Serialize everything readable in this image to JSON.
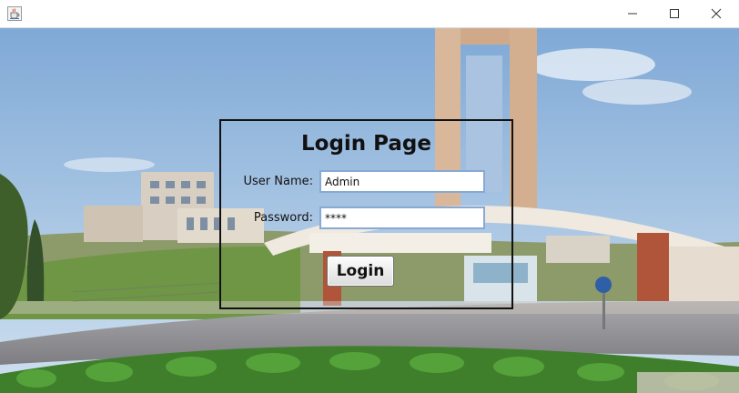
{
  "window": {
    "app_icon": "java-cup-icon",
    "controls": {
      "minimize_icon": "minimize-icon",
      "maximize_icon": "maximize-icon",
      "close_icon": "close-icon"
    }
  },
  "background": {
    "description_icon": "campus-photo"
  },
  "login": {
    "title": "Login Page",
    "username_label": "User Name:",
    "username_value": "Admin",
    "password_label": "Password:",
    "password_value": "****",
    "button_label": "Login"
  },
  "colors": {
    "field_border": "#86a9d6",
    "panel_border": "#111111",
    "sky": "#8fb4da"
  }
}
